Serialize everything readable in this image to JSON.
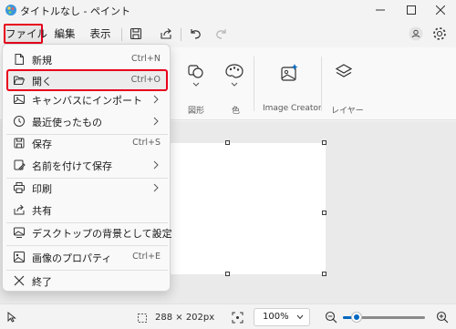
{
  "window": {
    "title": "タイトルなし - ペイント"
  },
  "menubar": {
    "file_label": "ファイル",
    "edit_label": "編集",
    "view_label": "表示"
  },
  "ribbon": {
    "groups": [
      {
        "label": "図形"
      },
      {
        "label": "色"
      },
      {
        "label": "Image Creator"
      },
      {
        "label": "レイヤー"
      }
    ]
  },
  "file_menu": {
    "items": [
      {
        "label": "新規",
        "shortcut": "Ctrl+N",
        "icon": "new-file-icon"
      },
      {
        "label": "開く",
        "shortcut": "Ctrl+O",
        "icon": "folder-open-icon",
        "selected": true
      },
      {
        "label": "キャンバスにインポート",
        "icon": "import-icon",
        "submenu": true
      },
      {
        "label": "最近使ったもの",
        "icon": "recent-icon",
        "submenu": true
      },
      {
        "label": "保存",
        "shortcut": "Ctrl+S",
        "icon": "save-icon"
      },
      {
        "label": "名前を付けて保存",
        "icon": "save-as-icon",
        "submenu": true
      },
      {
        "label": "印刷",
        "icon": "print-icon",
        "submenu": true
      },
      {
        "label": "共有",
        "icon": "share-icon"
      },
      {
        "label": "デスクトップの背景として設定",
        "icon": "wallpaper-icon",
        "submenu": true
      },
      {
        "label": "画像のプロパティ",
        "shortcut": "Ctrl+E",
        "icon": "image-properties-icon"
      },
      {
        "label": "終了",
        "icon": "close-icon"
      }
    ]
  },
  "status": {
    "canvas_size": "288 × 202px",
    "zoom": "100%",
    "zoom_level": 0.17
  },
  "colors": {
    "highlight": "#e8001c",
    "accent": "#0067c0"
  }
}
